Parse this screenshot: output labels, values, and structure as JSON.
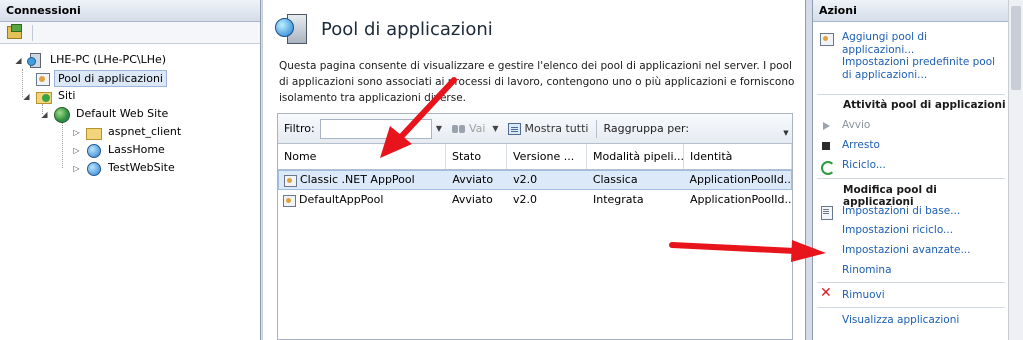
{
  "left_panel": {
    "title": "Connessioni",
    "tree": {
      "server": "LHE-PC (LHe-PC\\LHe)",
      "app_pools": "Pool di applicazioni",
      "sites": "Siti",
      "default_site": "Default Web Site",
      "children": [
        "aspnet_client",
        "LassHome",
        "TestWebSite"
      ]
    }
  },
  "center": {
    "title": "Pool di applicazioni",
    "description": "Questa pagina consente di visualizzare e gestire l'elenco dei pool di applicazioni nel server. I pool di applicazioni sono associati ai processi di lavoro, contengono uno o più applicazioni e forniscono isolamento tra applicazioni diverse.",
    "toolbar": {
      "filter_label": "Filtro:",
      "filter_value": "",
      "go_label": "Vai",
      "show_all_label": "Mostra tutti",
      "group_by_label": "Raggruppa per:"
    },
    "columns": [
      "Nome",
      "Stato",
      "Versione ...",
      "Modalità pipeli...",
      "Identità"
    ],
    "rows": [
      {
        "name": "Classic .NET AppPool",
        "state": "Avviato",
        "version": "v2.0",
        "mode": "Classica",
        "identity": "ApplicationPoolId..."
      },
      {
        "name": "DefaultAppPool",
        "state": "Avviato",
        "version": "v2.0",
        "mode": "Integrata",
        "identity": "ApplicationPoolId..."
      }
    ]
  },
  "right_panel": {
    "title": "Azioni",
    "add_pool_1": "Aggiungi pool di",
    "add_pool_2": "applicazioni...",
    "defaults_1": "Impostazioni predefinite pool",
    "defaults_2": "di applicazioni...",
    "section_tasks": "Attività pool di applicazioni",
    "start": "Avvio",
    "stop": "Arresto",
    "recycle": "Riciclo...",
    "section_edit": "Modifica pool di applicazioni",
    "basic_settings": "Impostazioni di base...",
    "recycle_settings": "Impostazioni riciclo...",
    "advanced_settings": "Impostazioni avanzate...",
    "rename": "Rinomina",
    "remove": "Rimuovi",
    "view_apps": "Visualizza applicazioni"
  },
  "colors": {
    "link": "#1c5fb4",
    "selection": "#dce9f9",
    "arrow": "#e8141b"
  }
}
